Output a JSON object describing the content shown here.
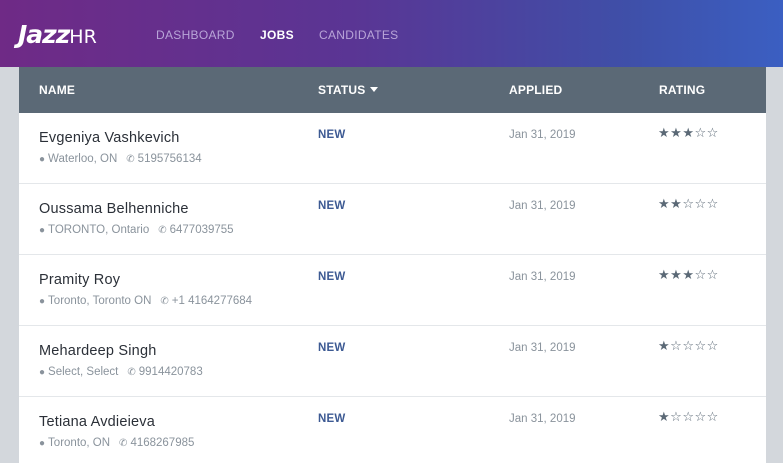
{
  "brand": {
    "logo_text": "Jazz",
    "logo_suffix": "HR"
  },
  "nav": {
    "items": [
      {
        "label": "DASHBOARD",
        "active": false
      },
      {
        "label": "JOBS",
        "active": true
      },
      {
        "label": "CANDIDATES",
        "active": false
      }
    ]
  },
  "table": {
    "headers": {
      "name": "NAME",
      "status": "STATUS",
      "applied": "APPLIED",
      "rating": "RATING"
    },
    "status_sort": "descending",
    "rows": [
      {
        "name": "Evgeniya Vashkevich",
        "location": "Waterloo, ON",
        "phone": "5195756134",
        "status": "NEW",
        "applied": "Jan 31, 2019",
        "rating": 3
      },
      {
        "name": "Oussama Belhenniche",
        "location": "TORONTO, Ontario",
        "phone": "6477039755",
        "status": "NEW",
        "applied": "Jan 31, 2019",
        "rating": 2
      },
      {
        "name": "Pramity Roy",
        "location": "Toronto, Toronto ON",
        "phone": "+1 4164277684",
        "status": "NEW",
        "applied": "Jan 31, 2019",
        "rating": 3
      },
      {
        "name": "Mehardeep Singh",
        "location": "Select, Select",
        "phone": "9914420783",
        "status": "NEW",
        "applied": "Jan 31, 2019",
        "rating": 1
      },
      {
        "name": "Tetiana Avdieieva",
        "location": "Toronto, ON",
        "phone": "4168267985",
        "status": "NEW",
        "applied": "Jan 31, 2019",
        "rating": 1
      }
    ],
    "rating_max": 5
  },
  "colors": {
    "nav_gradient_start": "#6f2a86",
    "nav_gradient_end": "#3b5fc2",
    "header_bg": "#5b6976",
    "status_text": "#3d5a93",
    "page_bg": "#d3d7dc"
  },
  "icons": {
    "location": "map-pin-icon",
    "phone": "phone-icon",
    "star_filled": "star-filled-icon",
    "star_empty": "star-outline-icon",
    "sort": "caret-down-icon"
  }
}
